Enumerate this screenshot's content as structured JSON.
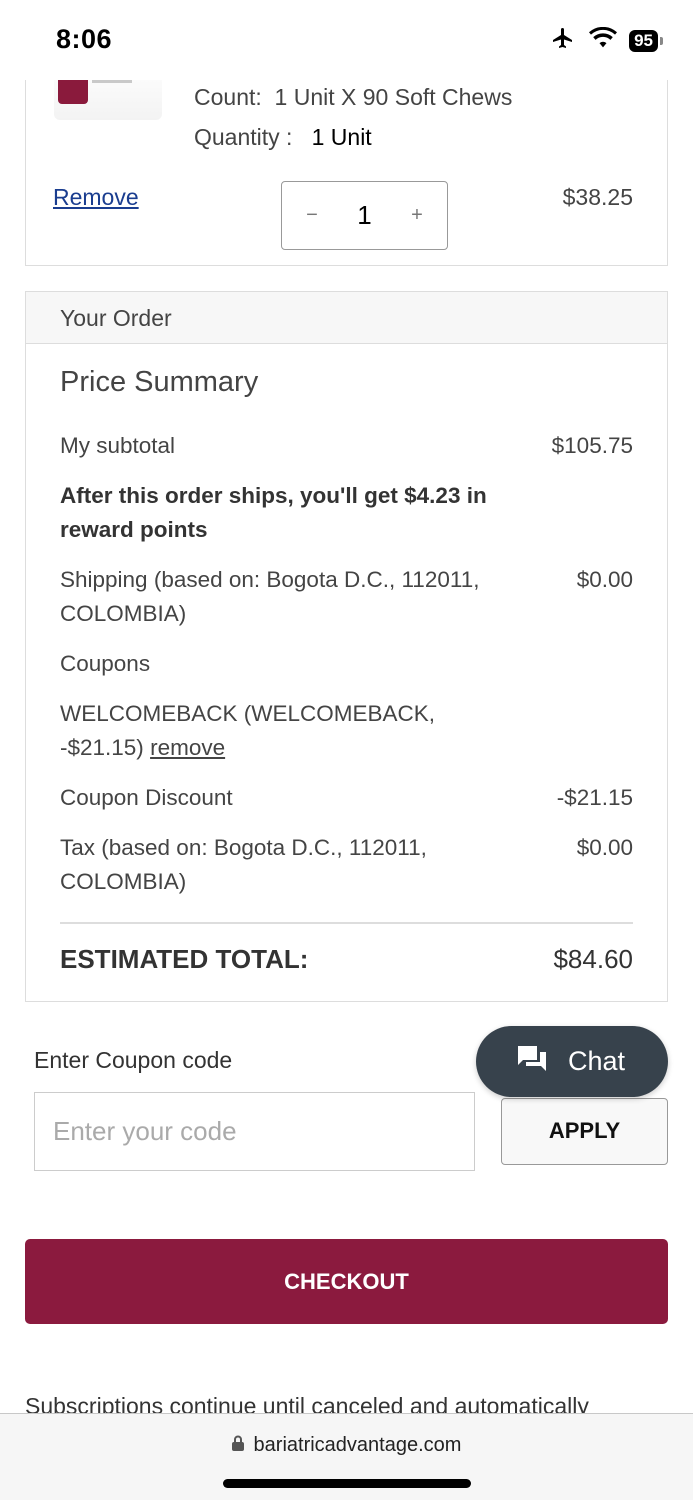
{
  "status_bar": {
    "time": "8:06",
    "battery": "95"
  },
  "cart_item": {
    "count_label": "Count:",
    "count_value": "1 Unit X 90 Soft Chews",
    "quantity_label": "Quantity :",
    "quantity_value": "1 Unit",
    "remove_label": "Remove",
    "stepper_value": "1",
    "stepper_minus": "−",
    "stepper_plus": "+",
    "price": "$38.25"
  },
  "order": {
    "header": "Your Order",
    "summary_title": "Price Summary",
    "subtotal_label": "My subtotal",
    "subtotal_value": "$105.75",
    "reward_text": "After this order ships, you'll get $4.23 in reward points",
    "shipping_label": "Shipping (based on: Bogota D.C., 112011, COLOMBIA)",
    "shipping_value": "$0.00",
    "coupons_label": "Coupons",
    "coupon_code_text": "WELCOMEBACK (WELCOMEBACK, -$21.15)",
    "coupon_remove": "remove",
    "coupon_discount_label": "Coupon Discount",
    "coupon_discount_value": "-$21.15",
    "tax_label": "Tax (based on: Bogota D.C., 112011, COLOMBIA)",
    "tax_value": "$0.00",
    "total_label": "ESTIMATED TOTAL:",
    "total_value": "$84.60"
  },
  "coupon": {
    "label": "Enter Coupon code",
    "placeholder": "Enter your code",
    "apply_label": "APPLY"
  },
  "chat": {
    "label": "Chat"
  },
  "checkout": {
    "label": "CHECKOUT"
  },
  "subscription_note": "Subscriptions continue until canceled and automatically",
  "browser": {
    "url": "bariatricadvantage.com"
  },
  "colors": {
    "brand": "#8b1a3e",
    "chat_bg": "#37424c",
    "link": "#1a3d8f"
  }
}
